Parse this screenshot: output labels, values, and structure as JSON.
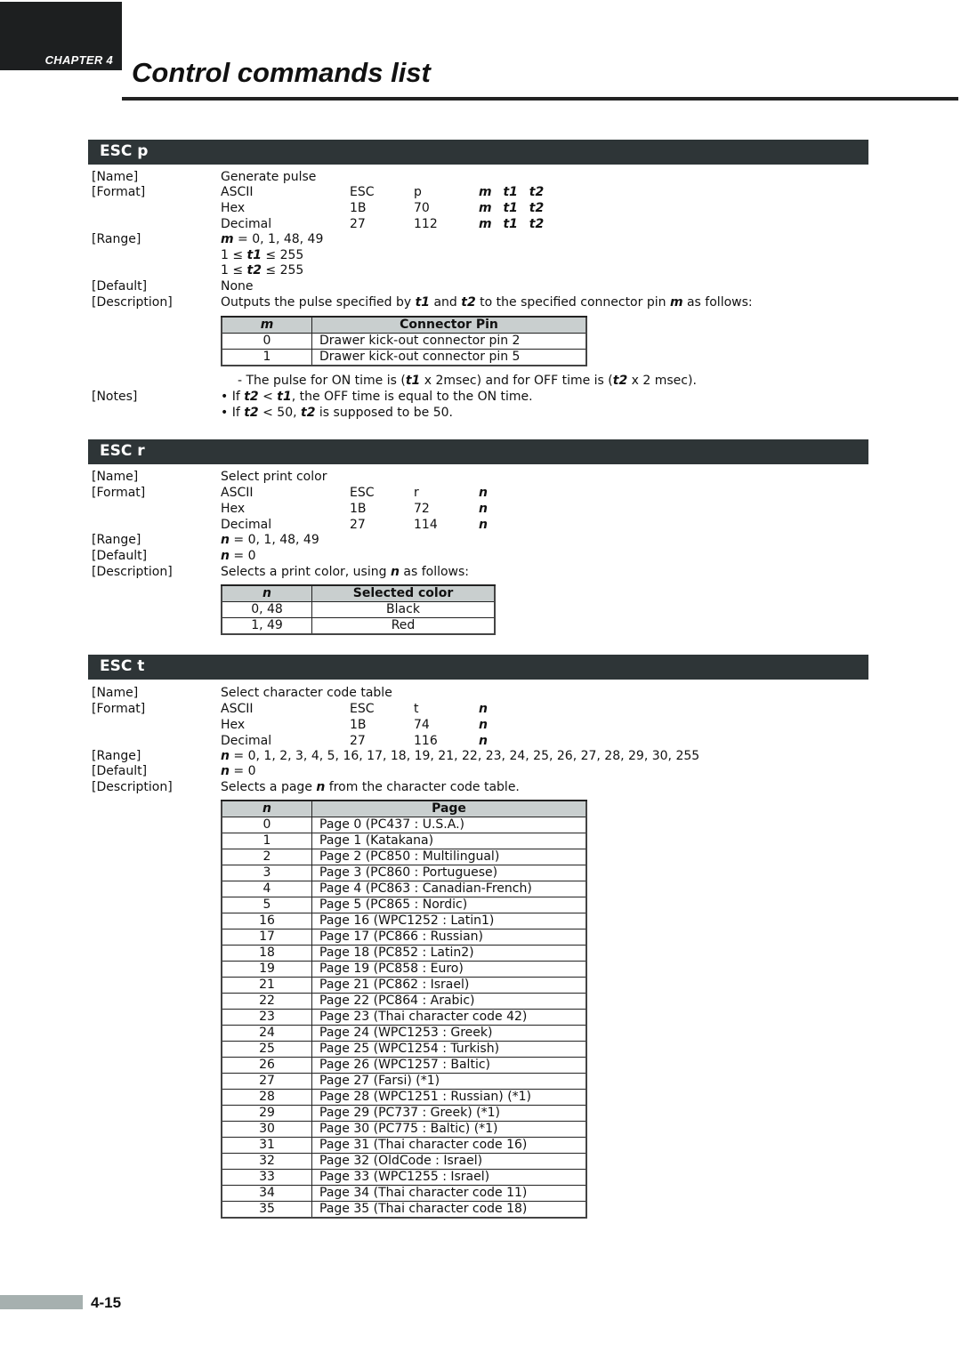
{
  "header": {
    "chapter": "CHAPTER 4",
    "title": "Control commands list"
  },
  "sections": {
    "esc_p": {
      "heading": "ESC p",
      "name_label": "[Name]",
      "name": "Generate pulse",
      "format_label": "[Format]",
      "format": [
        {
          "type": "ASCII",
          "b1": "ESC",
          "b2": "p",
          "params": "m t1 t2"
        },
        {
          "type": "Hex",
          "b1": "1B",
          "b2": "70",
          "params": "m t1 t2"
        },
        {
          "type": "Decimal",
          "b1": "27",
          "b2": "112",
          "params": "m t1 t2"
        }
      ],
      "range_label": "[Range]",
      "range": [
        "m = 0, 1, 48, 49",
        "1 ≤ t1 ≤ 255",
        "1 ≤ t2 ≤ 255"
      ],
      "default_label": "[Default]",
      "default": "None",
      "description_label": "[Description]",
      "description": "Outputs the pulse specified by t1 and t2 to the specified connector pin m as follows:",
      "table": {
        "headers": [
          "m",
          "Connector Pin"
        ],
        "rows": [
          [
            "0",
            "Drawer kick-out connector pin 2"
          ],
          [
            "1",
            "Drawer kick-out connector pin 5"
          ]
        ]
      },
      "pulse_note": "- The pulse for ON time is (t1 x 2msec) and for OFF time is (t2 x 2 msec).",
      "notes_label": "[Notes]",
      "notes": [
        "• If t2 < t1, the OFF time is equal to the ON time.",
        "• If t2 < 50, t2 is supposed to be 50."
      ]
    },
    "esc_r": {
      "heading": "ESC r",
      "name_label": "[Name]",
      "name": "Select print color",
      "format_label": "[Format]",
      "format": [
        {
          "type": "ASCII",
          "b1": "ESC",
          "b2": "r",
          "params": "n"
        },
        {
          "type": "Hex",
          "b1": "1B",
          "b2": "72",
          "params": "n"
        },
        {
          "type": "Decimal",
          "b1": "27",
          "b2": "114",
          "params": "n"
        }
      ],
      "range_label": "[Range]",
      "range": "n = 0, 1, 48, 49",
      "default_label": "[Default]",
      "default": "n = 0",
      "description_label": "[Description]",
      "description": "Selects a print color, using n as follows:",
      "table": {
        "headers": [
          "n",
          "Selected color"
        ],
        "rows": [
          [
            "0, 48",
            "Black"
          ],
          [
            "1, 49",
            "Red"
          ]
        ]
      }
    },
    "esc_t": {
      "heading": "ESC t",
      "name_label": "[Name]",
      "name": "Select character code table",
      "format_label": "[Format]",
      "format": [
        {
          "type": "ASCII",
          "b1": "ESC",
          "b2": "t",
          "params": "n"
        },
        {
          "type": "Hex",
          "b1": "1B",
          "b2": "74",
          "params": "n"
        },
        {
          "type": "Decimal",
          "b1": "27",
          "b2": "116",
          "params": "n"
        }
      ],
      "range_label": "[Range]",
      "range": "n = 0, 1, 2, 3, 4, 5, 16, 17, 18, 19, 21, 22, 23, 24, 25, 26, 27, 28, 29, 30, 255",
      "default_label": "[Default]",
      "default": "n = 0",
      "description_label": "[Description]",
      "description": "Selects a page n from the character code table.",
      "table": {
        "headers": [
          "n",
          "Page"
        ],
        "rows": [
          [
            "0",
            "Page 0 (PC437 : U.S.A.)"
          ],
          [
            "1",
            "Page 1 (Katakana)"
          ],
          [
            "2",
            "Page 2 (PC850 : Multilingual)"
          ],
          [
            "3",
            "Page 3 (PC860 : Portuguese)"
          ],
          [
            "4",
            "Page 4 (PC863 : Canadian-French)"
          ],
          [
            "5",
            "Page 5 (PC865 : Nordic)"
          ],
          [
            "16",
            "Page 16 (WPC1252 : Latin1)"
          ],
          [
            "17",
            "Page 17 (PC866 : Russian)"
          ],
          [
            "18",
            "Page 18 (PC852 : Latin2)"
          ],
          [
            "19",
            "Page 19 (PC858 : Euro)"
          ],
          [
            "21",
            "Page 21 (PC862 : Israel)"
          ],
          [
            "22",
            "Page 22 (PC864 : Arabic)"
          ],
          [
            "23",
            "Page 23 (Thai character code 42)"
          ],
          [
            "24",
            "Page 24 (WPC1253 : Greek)"
          ],
          [
            "25",
            "Page 25 (WPC1254 : Turkish)"
          ],
          [
            "26",
            "Page 26 (WPC1257 : Baltic)"
          ],
          [
            "27",
            "Page 27 (Farsi) (*1)"
          ],
          [
            "28",
            "Page 28 (WPC1251 : Russian) (*1)"
          ],
          [
            "29",
            "Page 29 (PC737 : Greek) (*1)"
          ],
          [
            "30",
            "Page 30 (PC775 : Baltic) (*1)"
          ],
          [
            "31",
            "Page 31 (Thai character code 16)"
          ],
          [
            "32",
            "Page 32 (OldCode : Israel)"
          ],
          [
            "33",
            "Page 33 (WPC1255 : Israel)"
          ],
          [
            "34",
            "Page 34 (Thai character code 11)"
          ],
          [
            "35",
            "Page 35 (Thai character code 18)"
          ]
        ]
      }
    }
  },
  "footer": {
    "page_number": "4-15"
  }
}
